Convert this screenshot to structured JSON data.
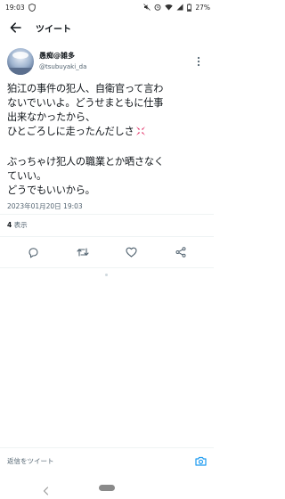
{
  "status_bar": {
    "time": "19:03",
    "battery": "27%",
    "icons": [
      "shield-icon",
      "mute-icon",
      "alarm-icon",
      "wifi-icon",
      "signal-icon",
      "battery-icon"
    ]
  },
  "header": {
    "title": "ツイート",
    "back_icon": "arrow-left-icon"
  },
  "tweet": {
    "author": {
      "display_name": "愚痴@雑多",
      "handle": "@tsubuyaki_da"
    },
    "body_lines": [
      "狛江の事件の犯人、自衛官って言わ",
      "ないでいいよ。どうせまともに仕事",
      "出来なかったから、",
      "ひとごろしに走ったんだしさ",
      "",
      "ぶっちゃけ犯人の職業とか晒さなく",
      "ていい。",
      "どうでもいいから。"
    ],
    "emoji_after_line_4": "anger-icon",
    "timestamp": "2023年01月20日 19:03",
    "views_count": "4",
    "views_label": " 表示"
  },
  "actions": {
    "icons": [
      "reply-icon",
      "retweet-icon",
      "like-icon",
      "share-icon"
    ]
  },
  "reply_bar": {
    "placeholder": "返信をツイート",
    "camera_icon": "camera-icon",
    "accent_color": "#1d9bf0"
  },
  "nav_bar": {
    "icons": [
      "nav-back-icon",
      "home-pill"
    ]
  }
}
